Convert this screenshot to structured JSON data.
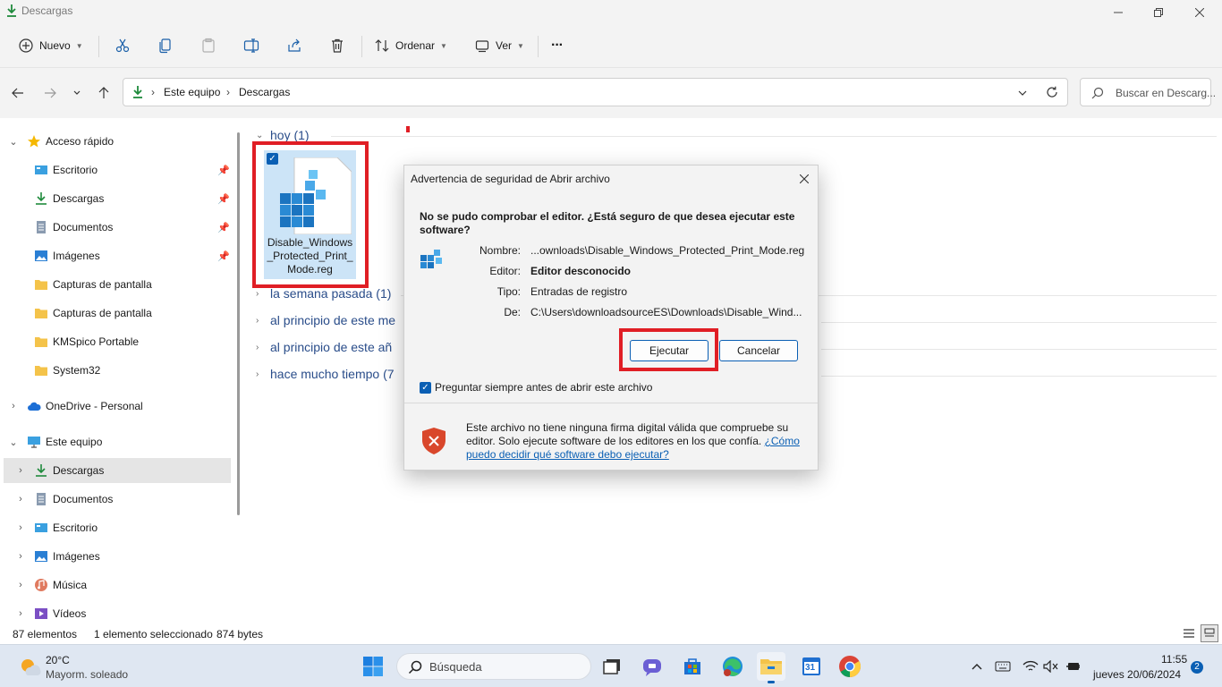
{
  "window": {
    "title": "Descargas"
  },
  "toolbar": {
    "new_label": "Nuevo",
    "sort_label": "Ordenar",
    "view_label": "Ver",
    "more_label": "···"
  },
  "address": {
    "crumbs": [
      "Este equipo",
      "Descargas"
    ],
    "search_placeholder": "Buscar en Descarg..."
  },
  "sidebar": {
    "quick_access": "Acceso rápido",
    "pinned": [
      "Escritorio",
      "Descargas",
      "Documentos",
      "Imágenes"
    ],
    "folders": [
      "Capturas de pantalla",
      "Capturas de pantalla",
      "KMSpico Portable",
      "System32"
    ],
    "onedrive": "OneDrive - Personal",
    "this_pc": "Este equipo",
    "pc_items": [
      "Descargas",
      "Documentos",
      "Escritorio",
      "Imágenes",
      "Música",
      "Vídeos"
    ]
  },
  "content": {
    "groups": [
      "hoy (1)",
      "la semana pasada (1)",
      "al principio de este me",
      "al principio de este añ",
      "hace mucho tiempo (7"
    ],
    "file_name": "Disable_Windows_Protected_Print_Mode.reg",
    "file_name_lines": [
      "Disable_Windows",
      "_Protected_Print_",
      "Mode.reg"
    ]
  },
  "status": {
    "count": "87 elementos",
    "selected": "1 elemento seleccionado",
    "size": "874 bytes"
  },
  "dialog": {
    "title": "Advertencia de seguridad de Abrir archivo",
    "question": "No se pudo comprobar el editor. ¿Está seguro de que desea ejecutar este software?",
    "fields": [
      {
        "label": "Nombre:",
        "value": "...ownloads\\Disable_Windows_Protected_Print_Mode.reg",
        "bold": false
      },
      {
        "label": "Editor:",
        "value": "Editor desconocido",
        "bold": true
      },
      {
        "label": "Tipo:",
        "value": "Entradas de registro",
        "bold": false
      },
      {
        "label": "De:",
        "value": "C:\\Users\\downloadsourceES\\Downloads\\Disable_Wind...",
        "bold": false
      }
    ],
    "run_label": "Ejecutar",
    "cancel_label": "Cancelar",
    "always_ask": "Preguntar siempre antes de abrir este archivo",
    "warning_text": "Este archivo no tiene ninguna firma digital válida que compruebe su editor. Solo ejecute software de los editores en los que confía.",
    "help_link": "¿Cómo puedo decidir qué software debo ejecutar?"
  },
  "taskbar": {
    "temp": "20°C",
    "weather": "Mayorm. soleado",
    "search_placeholder": "Búsqueda",
    "time": "11:55",
    "date": "jueves 20/06/2024",
    "notifications": "2",
    "calendar_day": "31"
  },
  "colors": {
    "accent": "#0a5fb4",
    "highlight_box": "#e01e25",
    "tile_selected": "#cce4f7"
  }
}
